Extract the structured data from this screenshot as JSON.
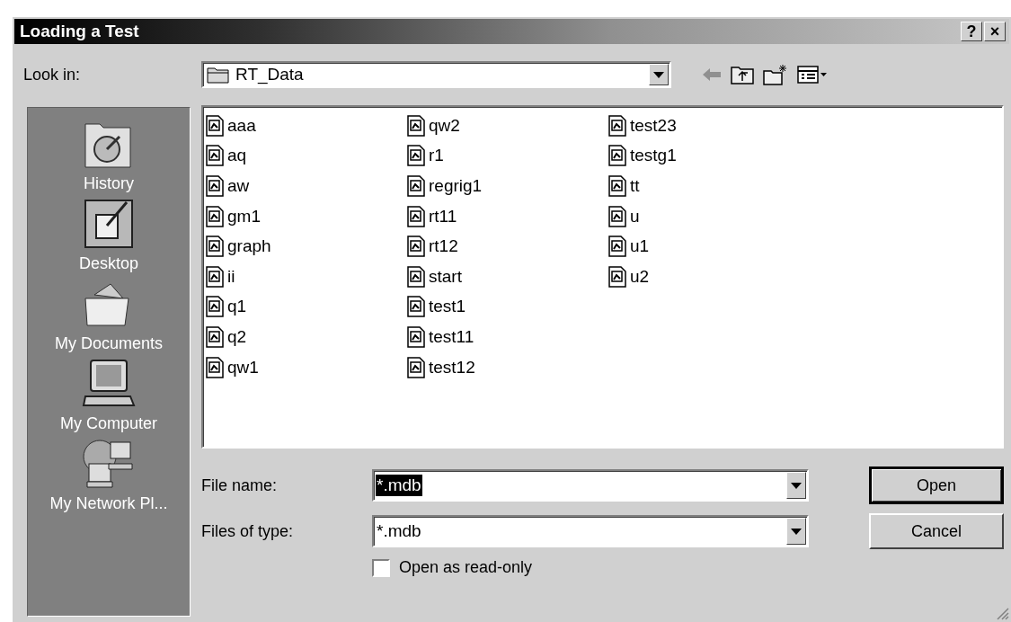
{
  "window": {
    "title": "Loading a Test",
    "title_buttons": [
      "?",
      "×"
    ]
  },
  "look_in": {
    "label": "Look in:",
    "value": "RT_Data"
  },
  "places": [
    {
      "label": "History",
      "kind": "history"
    },
    {
      "label": "Desktop",
      "kind": "desktop"
    },
    {
      "label": "My Documents",
      "kind": "documents"
    },
    {
      "label": "My Computer",
      "kind": "computer"
    },
    {
      "label": "My Network Pl...",
      "kind": "network"
    }
  ],
  "files": [
    "aaa",
    "aq",
    "aw",
    "gm1",
    "graph",
    "ii",
    "q1",
    "q2",
    "qw1",
    "qw2",
    "r1",
    "regrig1",
    "rt11",
    "rt12",
    "start",
    "test1",
    "test11",
    "test12",
    "test23",
    "testg1",
    "tt",
    "u",
    "u1",
    "u2"
  ],
  "file_name": {
    "label": "File name:",
    "value": "*.mdb",
    "text_selected": true
  },
  "file_type": {
    "label": "Files of type:",
    "value": "*.mdb"
  },
  "read_only": {
    "label": "Open as read-only",
    "checked": false
  },
  "buttons": [
    {
      "label": "Open",
      "default": true
    },
    {
      "label": "Cancel",
      "default": false
    }
  ]
}
